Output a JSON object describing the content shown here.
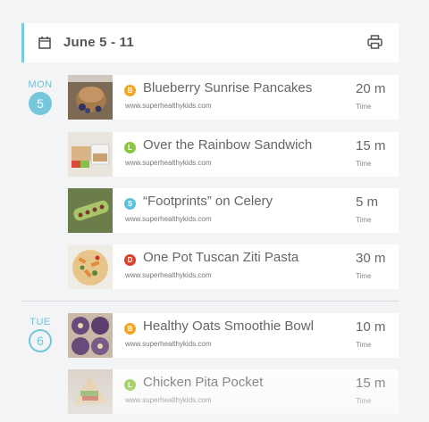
{
  "header": {
    "week": "June 5 - 11"
  },
  "days": [
    {
      "name": "MON",
      "number": "5"
    },
    {
      "name": "TUE",
      "number": "6"
    }
  ],
  "meals": [
    {
      "type": "B",
      "color": "#f4a623",
      "title": "Blueberry Sunrise Pancakes",
      "source": "www.superhealthykids.com",
      "time": "20 m",
      "time_label": "Time"
    },
    {
      "type": "L",
      "color": "#8cc63f",
      "title": "Over the Rainbow Sandwich",
      "source": "www.superhealthykids.com",
      "time": "15 m",
      "time_label": "Time"
    },
    {
      "type": "S",
      "color": "#5bc0de",
      "title": "“Footprints” on Celery",
      "source": "www.superhealthykids.com",
      "time": "5 m",
      "time_label": "Time"
    },
    {
      "type": "D",
      "color": "#d9412c",
      "title": "One Pot Tuscan Ziti Pasta",
      "source": "www.superhealthykids.com",
      "time": "30 m",
      "time_label": "Time"
    },
    {
      "type": "B",
      "color": "#f4a623",
      "title": "Healthy Oats Smoothie Bowl",
      "source": "www.superhealthykids.com",
      "time": "10 m",
      "time_label": "Time"
    },
    {
      "type": "L",
      "color": "#8cc63f",
      "title": "Chicken Pita Pocket",
      "source": "www.superhealthykids.com",
      "time": "15 m",
      "time_label": "Time"
    }
  ]
}
